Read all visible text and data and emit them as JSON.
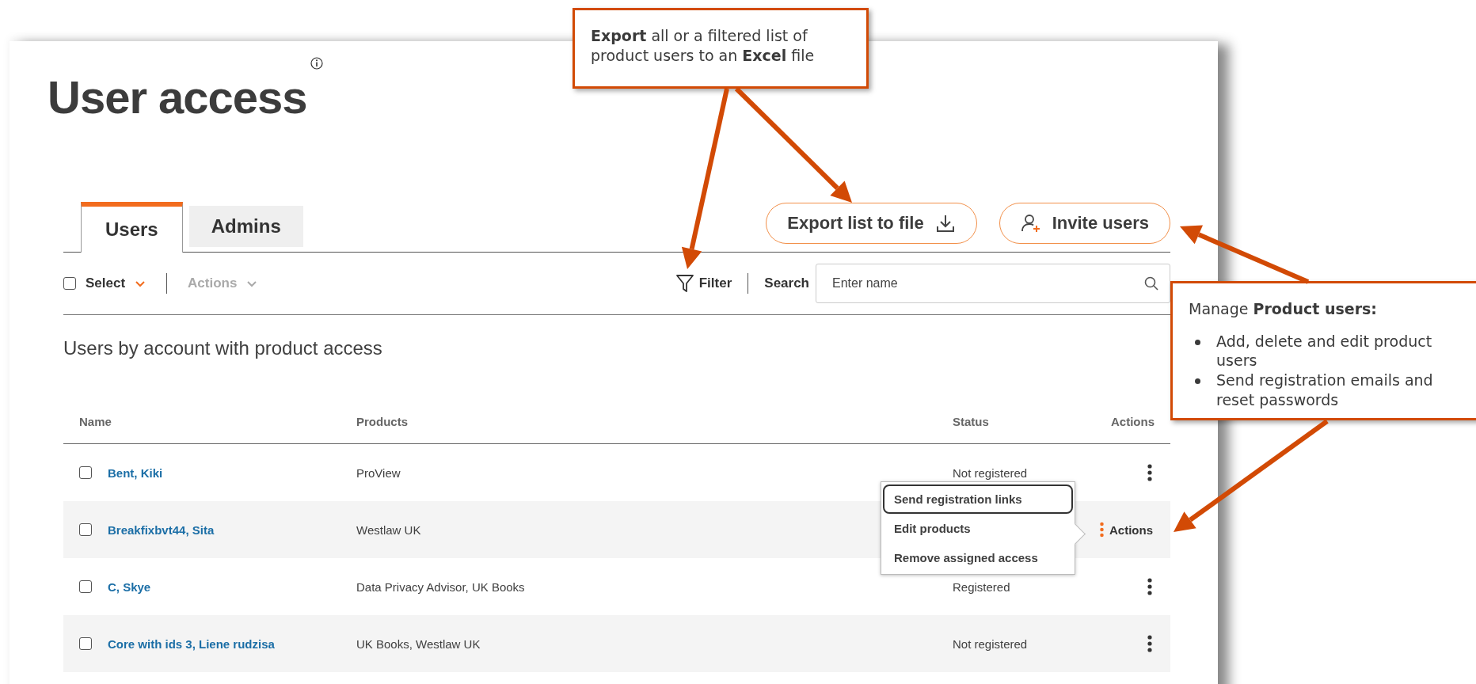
{
  "page": {
    "title": "User access"
  },
  "tabs": [
    {
      "label": "Users",
      "selected": true
    },
    {
      "label": "Admins",
      "selected": false
    }
  ],
  "buttons": [
    {
      "label": "Export list to file",
      "kind": "export"
    },
    {
      "label": "Invite users",
      "kind": "invite"
    }
  ],
  "toolbar": {
    "select": {
      "label": "Select",
      "checked": false
    },
    "actions": {
      "label": "Actions",
      "disabled": true
    },
    "filter": {
      "label": "Filter"
    },
    "search": {
      "label": "Search",
      "placeholder": "Enter name"
    }
  },
  "table": {
    "caption": "Users by account with product access",
    "columns": [
      "Name",
      "Products",
      "Status",
      "Actions"
    ],
    "rows": [
      {
        "name": "Bent, Kiki",
        "products": "ProView",
        "status": "Not registered",
        "checked": false,
        "menu_open": false
      },
      {
        "name": "Breakfixbvt44, Sita",
        "products": "Westlaw UK",
        "checked": false,
        "menu_open": true,
        "action_label": "Actions"
      },
      {
        "name": "C, Skye",
        "products": "Data Privacy Advisor, UK Books",
        "status": "Registered",
        "checked": false,
        "menu_open": false
      },
      {
        "name": "Core with ids 3, Liene rudzisa",
        "products": "UK Books, Westlaw UK",
        "status": "Not registered",
        "checked": false,
        "menu_open": false
      }
    ]
  },
  "menu": {
    "items": [
      {
        "label": "Send registration links",
        "focused": true
      },
      {
        "label": "Edit products",
        "focused": false
      },
      {
        "label": "Remove assigned access",
        "focused": false
      }
    ]
  },
  "callouts": [
    {
      "text": "**Export** all or a filtered list of product users to an **Excel** file"
    },
    {
      "text": "Manage **Product users:**",
      "bullets": [
        "Add, delete and edit product users",
        "Send registration emails and reset passwords"
      ]
    }
  ]
}
